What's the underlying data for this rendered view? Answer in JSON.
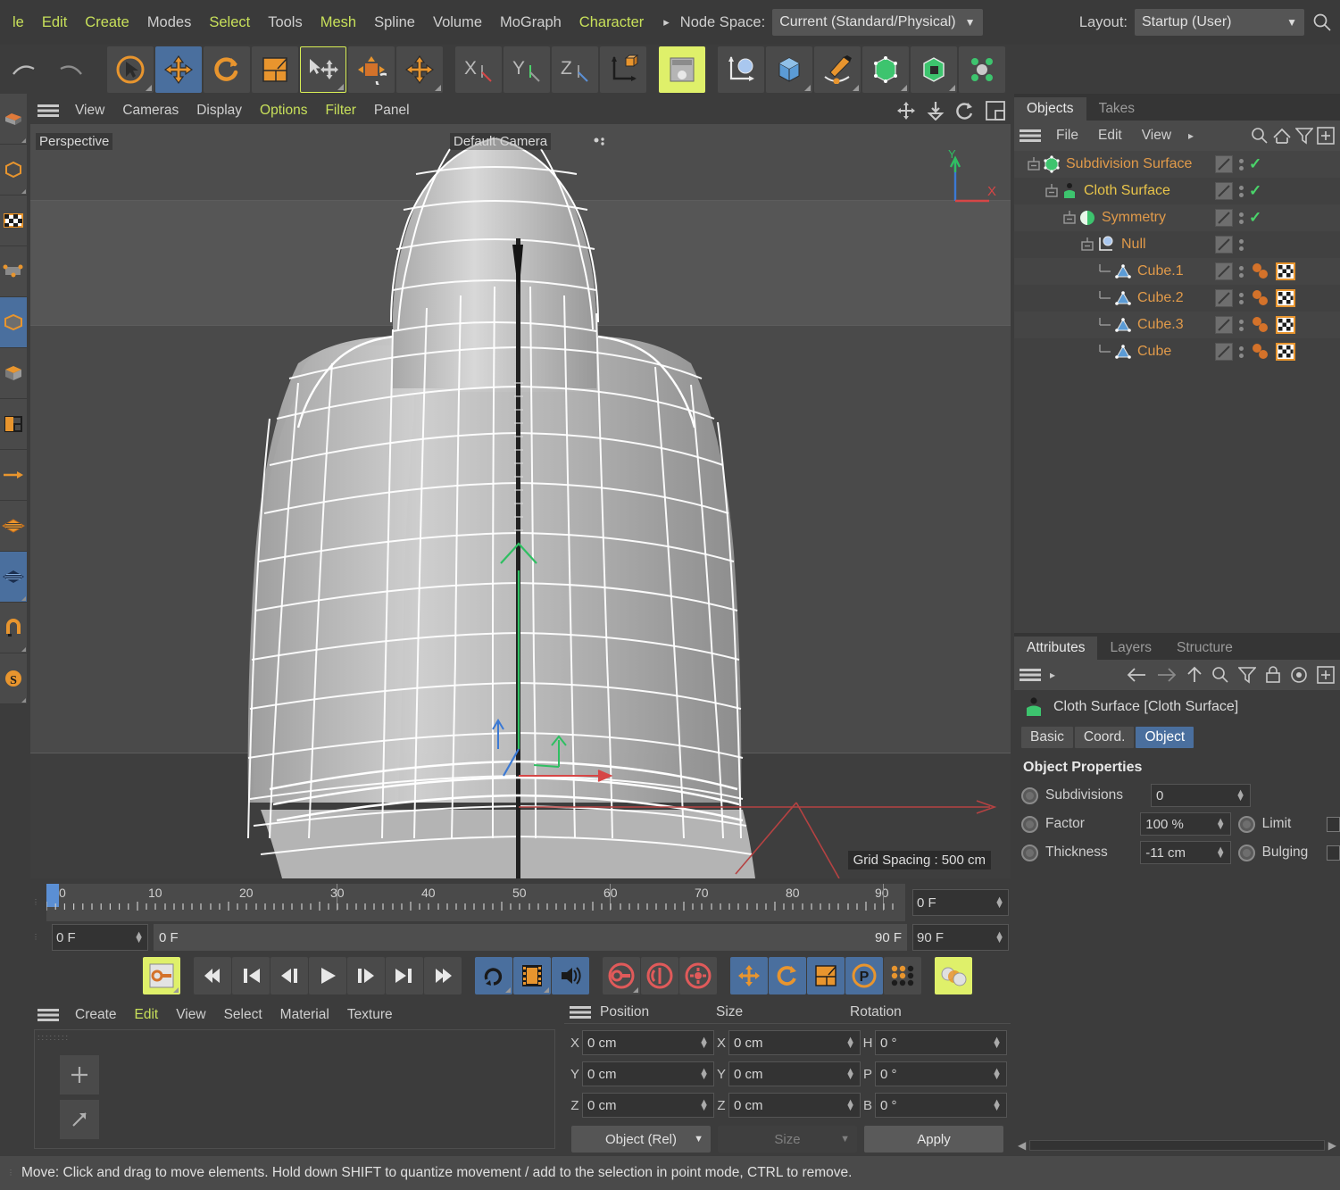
{
  "menubar": {
    "items": [
      {
        "label": "le",
        "lime": true
      },
      {
        "label": "Edit",
        "lime": true
      },
      {
        "label": "Create",
        "lime": true
      },
      {
        "label": "Modes",
        "lime": false
      },
      {
        "label": "Select",
        "lime": true
      },
      {
        "label": "Tools",
        "lime": false
      },
      {
        "label": "Mesh",
        "lime": true
      },
      {
        "label": "Spline",
        "lime": false
      },
      {
        "label": "Volume",
        "lime": false
      },
      {
        "label": "MoGraph",
        "lime": false
      },
      {
        "label": "Character",
        "lime": true
      }
    ],
    "overflow_arrow": "▸",
    "node_space_label": "Node Space:",
    "node_space_value": "Current (Standard/Physical)",
    "layout_label": "Layout:",
    "layout_value": "Startup (User)",
    "search_icon": "search-icon"
  },
  "viewport": {
    "menu": [
      {
        "label": "View",
        "lime": false
      },
      {
        "label": "Cameras",
        "lime": false
      },
      {
        "label": "Display",
        "lime": false
      },
      {
        "label": "Options",
        "lime": true
      },
      {
        "label": "Filter",
        "lime": true
      },
      {
        "label": "Panel",
        "lime": false
      }
    ],
    "perspective_label": "Perspective",
    "camera_label": "Default Camera",
    "grid_spacing": "Grid Spacing : 500 cm",
    "axis_x": "X",
    "axis_y": "Y"
  },
  "timeline": {
    "ticks": [
      "0",
      "10",
      "20",
      "30",
      "40",
      "50",
      "60",
      "70",
      "80",
      "90"
    ],
    "current_frame": "0 F",
    "end_frame": "90 F",
    "range_start": "0 F",
    "range_end": "90 F",
    "field_left": "0 F",
    "field_right_top": "0 F",
    "field_right_bottom": "90 F"
  },
  "material_manager": {
    "menu": [
      {
        "label": "Create",
        "lime": false
      },
      {
        "label": "Edit",
        "lime": true
      },
      {
        "label": "View",
        "lime": false
      },
      {
        "label": "Select",
        "lime": false
      },
      {
        "label": "Material",
        "lime": false
      },
      {
        "label": "Texture",
        "lime": false
      }
    ]
  },
  "coordinates": {
    "headers": [
      "Position",
      "Size",
      "Rotation"
    ],
    "rows": [
      {
        "pl": "X",
        "pv": "0 cm",
        "sl": "X",
        "sv": "0 cm",
        "rl": "H",
        "rv": "0 °"
      },
      {
        "pl": "Y",
        "pv": "0 cm",
        "sl": "Y",
        "sv": "0 cm",
        "rl": "P",
        "rv": "0 °"
      },
      {
        "pl": "Z",
        "pv": "0 cm",
        "sl": "Z",
        "sv": "0 cm",
        "rl": "B",
        "rv": "0 °"
      }
    ],
    "mode_select": "Object (Rel)",
    "size_select": "Size",
    "apply_label": "Apply"
  },
  "objects_panel": {
    "tabs": [
      {
        "label": "Objects",
        "active": true
      },
      {
        "label": "Takes",
        "active": false
      }
    ],
    "menu": [
      {
        "label": "File"
      },
      {
        "label": "Edit"
      },
      {
        "label": "View"
      }
    ],
    "overflow_arrow": "▸",
    "tree": [
      {
        "name": "Subdivision Surface",
        "depth": 0,
        "icon": "subdivision-surface-icon",
        "check": true,
        "tags": false,
        "color": "#e09a4a"
      },
      {
        "name": "Cloth Surface",
        "depth": 1,
        "icon": "cloth-surface-icon",
        "check": true,
        "tags": false,
        "color": "#e8c44a"
      },
      {
        "name": "Symmetry",
        "depth": 2,
        "icon": "symmetry-icon",
        "check": true,
        "tags": false,
        "color": "#e09a4a"
      },
      {
        "name": "Null",
        "depth": 3,
        "icon": "null-icon",
        "check": false,
        "tags": false,
        "color": "#e09a4a"
      },
      {
        "name": "Cube.1",
        "depth": 4,
        "icon": "polygon-object-icon",
        "check": false,
        "tags": true,
        "color": "#e09a4a"
      },
      {
        "name": "Cube.2",
        "depth": 4,
        "icon": "polygon-object-icon",
        "check": false,
        "tags": true,
        "color": "#e09a4a"
      },
      {
        "name": "Cube.3",
        "depth": 4,
        "icon": "polygon-object-icon",
        "check": false,
        "tags": true,
        "color": "#e09a4a"
      },
      {
        "name": "Cube",
        "depth": 4,
        "icon": "polygon-object-icon",
        "check": false,
        "tags": true,
        "color": "#e09a4a"
      }
    ]
  },
  "attributes_panel": {
    "tabs": [
      {
        "label": "Attributes",
        "active": true
      },
      {
        "label": "Layers",
        "active": false
      },
      {
        "label": "Structure",
        "active": false
      }
    ],
    "object_title": "Cloth Surface [Cloth Surface]",
    "subtabs": [
      {
        "label": "Basic",
        "active": false
      },
      {
        "label": "Coord.",
        "active": false
      },
      {
        "label": "Object",
        "active": true
      }
    ],
    "section_title": "Object Properties",
    "properties": [
      {
        "label": "Subdivisions",
        "value": "0",
        "extra_label": "",
        "extra_check": false
      },
      {
        "label": "Factor",
        "value": "100 %",
        "extra_label": "Limit",
        "extra_check": true
      },
      {
        "label": "Thickness",
        "value": "-11 cm",
        "extra_label": "Bulging",
        "extra_check": true
      }
    ]
  },
  "status_bar": {
    "text": "Move: Click and drag to move elements. Hold down SHIFT to quantize movement / add to the selection in point mode, CTRL to remove."
  },
  "colors": {
    "accent_orange": "#e8952e",
    "accent_blue": "#4a6f9e",
    "accent_lime": "#dff06a",
    "accent_green": "#4ad46a",
    "tree_orange": "#e09a4a",
    "bg_panel": "#3c3c3c"
  }
}
